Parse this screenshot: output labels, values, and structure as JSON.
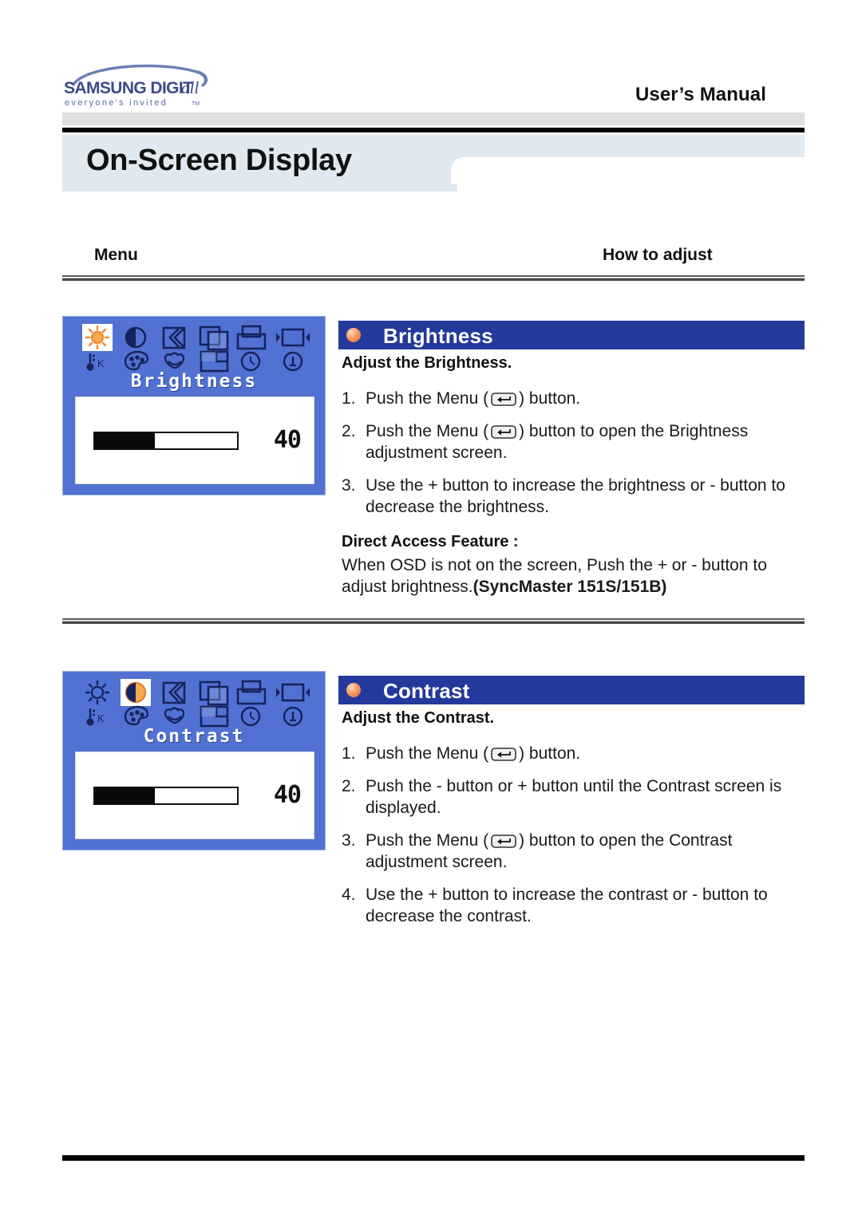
{
  "header": {
    "logo_main": "SAMSUNG DIGITall",
    "logo_tagline": "everyone's invitedTM",
    "manual_label": "User’s Manual"
  },
  "page_title": "On-Screen Display",
  "columns": {
    "menu_label": "Menu",
    "howto_label": "How to adjust"
  },
  "colors": {
    "osd_blue": "#5172d3",
    "section_header_navy": "#23399b",
    "bullet_orange": "#f0804e",
    "title_band": "#dfe9ef",
    "highlight_white": "#ffffff"
  },
  "sections": [
    {
      "id": "brightness",
      "title": "Brightness",
      "subhead": "Adjust the Brightness.",
      "osd": {
        "title": "Brightness",
        "value": "40",
        "fill_percent": 42,
        "selected_icon_index": 0,
        "icons": [
          "brightness-sun-icon",
          "contrast-halfmoon-icon",
          "sharpness-icon",
          "position-h-icon",
          "position-v-icon",
          "image-size-icon",
          "color-temperature-icon",
          "color-control-icon",
          "color-tone-icon",
          "osd-position-icon",
          "clock-phase-icon",
          "information-icon"
        ]
      },
      "steps": [
        {
          "num": "1.",
          "pre": "Push the Menu (",
          "key": "menu-enter-key",
          "post": ") button."
        },
        {
          "num": "2.",
          "pre": "Push the Menu (",
          "key": "menu-enter-key",
          "post": ") button to open the Brightness adjustment screen."
        },
        {
          "num": "3.",
          "pre": "Use the + button to increase the brightness or - button to decrease the brightness.",
          "key": "",
          "post": ""
        }
      ],
      "direct_access": {
        "label": "Direct Access Feature :",
        "body_plain": "When OSD is not on the screen, Push the + or - button to adjust brightness.",
        "body_bold": "(SyncMaster 151S/151B)"
      }
    },
    {
      "id": "contrast",
      "title": "Contrast",
      "subhead": "Adjust the Contrast.",
      "osd": {
        "title": "Contrast",
        "value": "40",
        "fill_percent": 42,
        "selected_icon_index": 1,
        "icons": [
          "brightness-sun-icon",
          "contrast-halfmoon-icon",
          "sharpness-icon",
          "position-h-icon",
          "position-v-icon",
          "image-size-icon",
          "color-temperature-icon",
          "color-control-icon",
          "color-tone-icon",
          "osd-position-icon",
          "clock-phase-icon",
          "information-icon"
        ]
      },
      "steps": [
        {
          "num": "1.",
          "pre": "Push the Menu (",
          "key": "menu-enter-key",
          "post": ") button."
        },
        {
          "num": "2.",
          "pre": "Push the - button or + button until the Contrast screen is displayed.",
          "key": "",
          "post": ""
        },
        {
          "num": "3.",
          "pre": "Push the Menu (",
          "key": "menu-enter-key",
          "post": ") button to open the Contrast adjustment screen."
        },
        {
          "num": "4.",
          "pre": "Use the + button to increase the contrast or - button to decrease the contrast.",
          "key": "",
          "post": ""
        }
      ],
      "direct_access": null
    }
  ]
}
